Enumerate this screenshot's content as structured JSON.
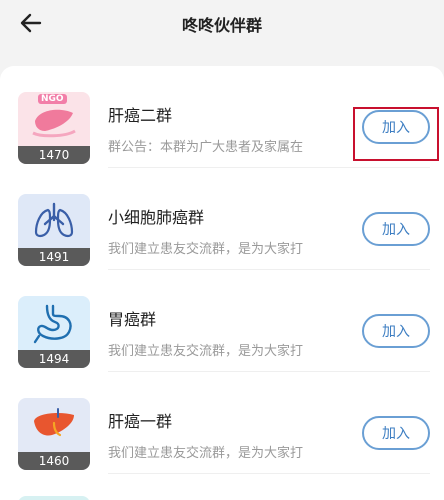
{
  "header": {
    "title": "咚咚伙伴群"
  },
  "groups": [
    {
      "name": "肝癌二群",
      "desc": "群公告：本群为广大患者及家属在",
      "count": "1470",
      "join": "加入",
      "badge": "NGO",
      "icon": "liver-ngo-icon"
    },
    {
      "name": "小细胞肺癌群",
      "desc": "我们建立患友交流群，是为大家打",
      "count": "1491",
      "join": "加入",
      "icon": "lungs-icon"
    },
    {
      "name": "胃癌群",
      "desc": "我们建立患友交流群，是为大家打",
      "count": "1494",
      "join": "加入",
      "icon": "stomach-icon"
    },
    {
      "name": "肝癌一群",
      "desc": "我们建立患友交流群，是为大家打",
      "count": "1460",
      "join": "加入",
      "icon": "liver-icon"
    }
  ],
  "colors": {
    "accent": "#3d7ec2",
    "highlight": "#c8102e"
  }
}
